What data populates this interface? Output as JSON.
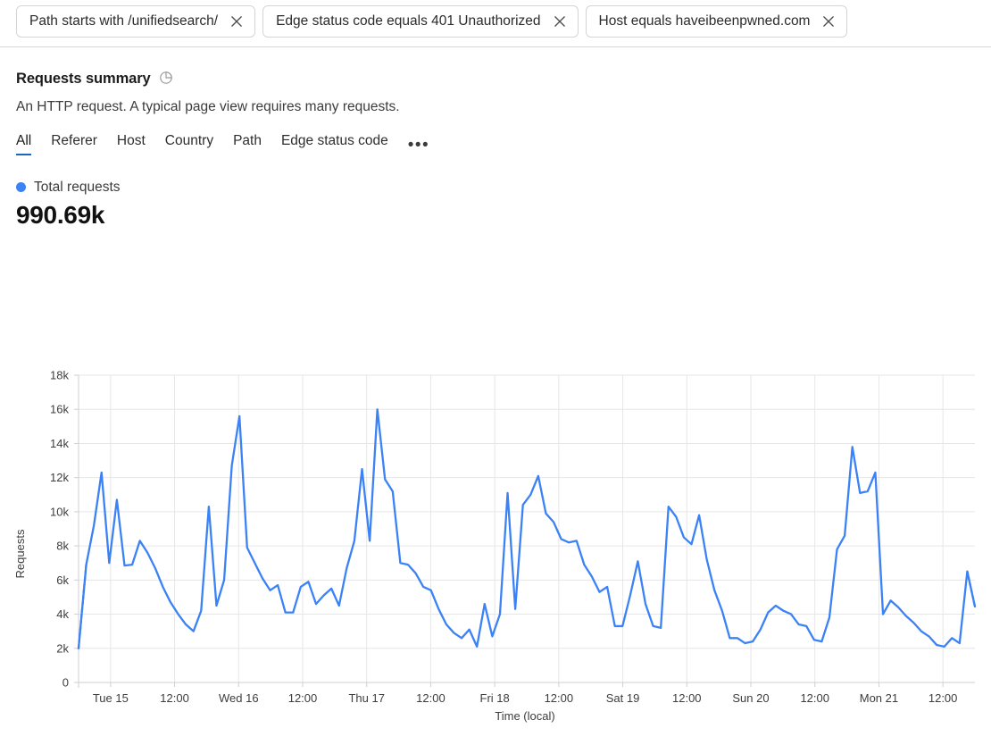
{
  "filters": [
    {
      "label": "Path starts with /unifiedsearch/",
      "close_icon": "close-icon"
    },
    {
      "label": "Edge status code equals 401 Unauthorized",
      "close_icon": "close-icon"
    },
    {
      "label": "Host equals haveibeenpwned.com",
      "close_icon": "close-icon"
    }
  ],
  "summary": {
    "title": "Requests summary",
    "title_icon": "pie-chart-icon",
    "subtitle": "An HTTP request. A typical page view requires many requests."
  },
  "tabs": [
    {
      "label": "All",
      "active": true
    },
    {
      "label": "Referer",
      "active": false
    },
    {
      "label": "Host",
      "active": false
    },
    {
      "label": "Country",
      "active": false
    },
    {
      "label": "Path",
      "active": false
    },
    {
      "label": "Edge status code",
      "active": false
    }
  ],
  "tabs_overflow": "•••",
  "metric": {
    "legend_label": "Total requests",
    "legend_color": "#3b82f6",
    "value": "990.69k"
  },
  "chart_data": {
    "type": "line",
    "title": "",
    "xlabel": "Time (local)",
    "ylabel": "Requests",
    "ylim": [
      0,
      18000
    ],
    "ytick_labels": [
      "0",
      "2k",
      "4k",
      "6k",
      "8k",
      "10k",
      "12k",
      "14k",
      "16k",
      "18k"
    ],
    "ytick_values": [
      0,
      2000,
      4000,
      6000,
      8000,
      10000,
      12000,
      14000,
      16000,
      18000
    ],
    "xtick_labels": [
      "Tue 15",
      "12:00",
      "Wed 16",
      "12:00",
      "Thu 17",
      "12:00",
      "Fri 18",
      "12:00",
      "Sat 19",
      "12:00",
      "Sun 20",
      "12:00",
      "Mon 21",
      "12:00"
    ],
    "grid": true,
    "legend_position": "above-chart",
    "line_color": "#3b82f6",
    "series": [
      {
        "name": "Total requests",
        "style_note": "dashed at both ends (partial intervals)",
        "dashed_head": [
          2000,
          6900
        ],
        "dashed_tail": [
          6500,
          4450
        ],
        "values": [
          2000,
          6900,
          9200,
          12300,
          7000,
          10700,
          6850,
          6900,
          8300,
          7600,
          6700,
          5600,
          4700,
          4000,
          3400,
          3000,
          4200,
          10300,
          4500,
          6000,
          12700,
          15600,
          7900,
          7000,
          6100,
          5400,
          5700,
          4100,
          4100,
          5600,
          5900,
          4600,
          5100,
          5500,
          4500,
          6700,
          8300,
          12500,
          8300,
          16000,
          11900,
          11200,
          7000,
          6900,
          6400,
          5600,
          5400,
          4300,
          3400,
          2900,
          2600,
          3100,
          2100,
          4600,
          2700,
          4000,
          11100,
          4300,
          10400,
          11000,
          12100,
          9900,
          9400,
          8400,
          8200,
          8300,
          6900,
          6200,
          5300,
          5600,
          3300,
          3300,
          5100,
          7100,
          4600,
          3300,
          3200,
          10300,
          9700,
          8500,
          8100,
          9800,
          7200,
          5400,
          4200,
          2600,
          2600,
          2300,
          2400,
          3100,
          4100,
          4500,
          4200,
          4000,
          3400,
          3300,
          2500,
          2400,
          3800,
          7800,
          8600,
          13800,
          11100,
          11200,
          12300,
          4000,
          4800,
          4400,
          3900,
          3500,
          3000,
          2700,
          2200,
          2100,
          2600,
          2300,
          6500,
          4450
        ]
      }
    ]
  }
}
